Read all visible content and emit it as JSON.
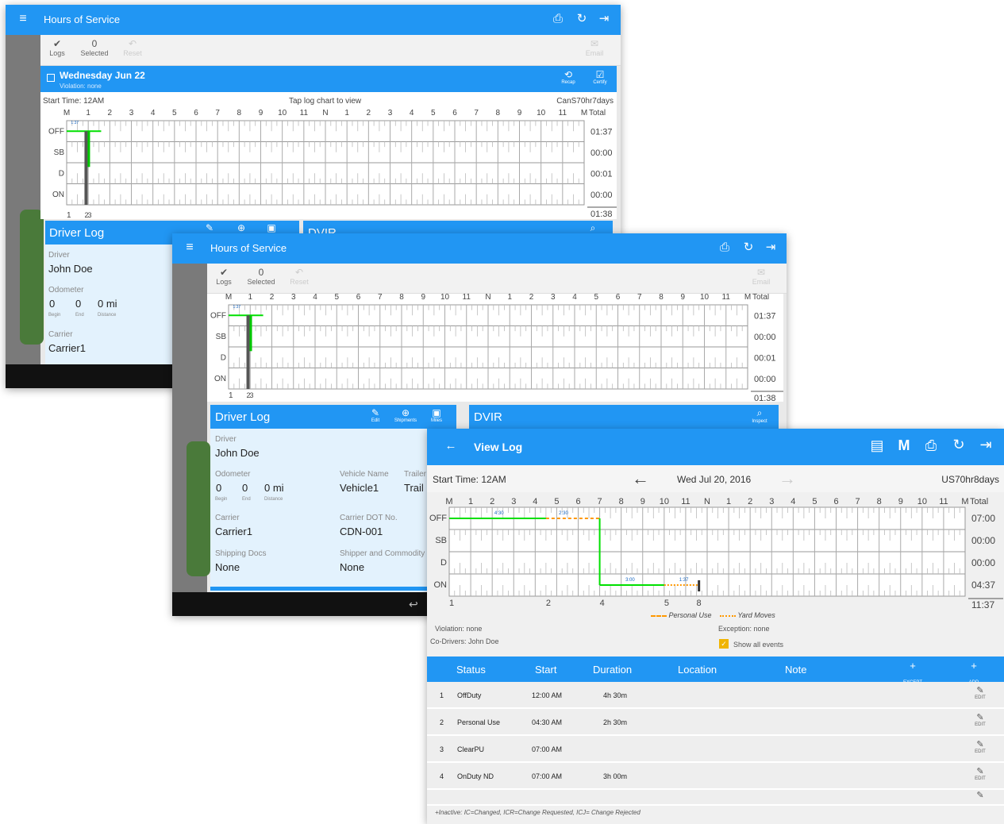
{
  "shot1": {
    "appbar": {
      "title": "Hours of Service"
    },
    "toolbar": {
      "logs": "Logs",
      "count": "0",
      "selected": "Selected",
      "reset": "Reset",
      "email": "Email"
    },
    "day": {
      "date": "Wednesday Jun 22",
      "violation": "Violation: none",
      "recap": "Recap",
      "certify": "Certify"
    },
    "chart": {
      "start_time": "Start Time: 12AM",
      "hint": "Tap log chart to view",
      "ruleset": "CanS70hr7days",
      "totals": [
        "01:37",
        "00:00",
        "00:01",
        "00:00"
      ],
      "grand_total": "01:38"
    },
    "driver_log": {
      "title": "Driver Log",
      "driver_label": "Driver",
      "driver": "John Doe",
      "odometer_label": "Odometer",
      "begin": "0",
      "end": "0",
      "distance": "0 mi",
      "begin_label": "Begin",
      "end_label": "End",
      "distance_label": "Distance",
      "carrier_label": "Carrier",
      "carrier": "Carrier1"
    },
    "dvir": {
      "title": "DVIR"
    }
  },
  "shot2": {
    "appbar": {
      "title": "Hours of Service"
    },
    "toolbar": {
      "logs": "Logs",
      "count": "0",
      "selected": "Selected",
      "reset": "Reset",
      "email": "Email"
    },
    "chart": {
      "totals": [
        "01:37",
        "00:00",
        "00:01",
        "00:00"
      ],
      "grand_total": "01:38"
    },
    "driver_log": {
      "title": "Driver Log",
      "edit": "Edit",
      "shipments": "Shipments",
      "miles": "Miles",
      "driver_label": "Driver",
      "driver": "John Doe",
      "odometer_label": "Odometer",
      "begin": "0",
      "end": "0",
      "distance": "0 mi",
      "begin_label": "Begin",
      "end_label": "End",
      "distance_label": "Distance",
      "vehicle_label": "Vehicle Name",
      "vehicle": "Vehicle1",
      "trailer_label": "Trailer",
      "trailer": "Trail",
      "carrier_label": "Carrier",
      "carrier": "Carrier1",
      "dot_label": "Carrier DOT No.",
      "dot": "CDN-001",
      "shipping_label": "Shipping Docs",
      "shipping": "None",
      "shipper_label": "Shipper and Commodity",
      "shipper": "None"
    },
    "dvir": {
      "title": "DVIR",
      "inspect": "Inspect"
    }
  },
  "shot3": {
    "appbar": {
      "title": "View Log"
    },
    "nav": {
      "start_time": "Start Time: 12AM",
      "date": "Wed Jul 20, 2016",
      "ruleset": "US70hr8days"
    },
    "chart": {
      "totals": [
        "07:00",
        "00:00",
        "00:00",
        "04:37"
      ],
      "grand_total": "11:37",
      "legend_personal": "Personal Use",
      "legend_yard": "Yard Moves"
    },
    "info": {
      "violation": "Violation: none",
      "codrivers": "Co-Drivers: John Doe",
      "exception": "Exception: none",
      "show_all": "Show all events"
    },
    "table": {
      "headers": {
        "status": "Status",
        "start": "Start",
        "duration": "Duration",
        "location": "Location",
        "note": "Note",
        "except": "EXCEPT",
        "add": "ADD"
      },
      "rows": [
        {
          "num": "1",
          "status": "OffDuty",
          "start": "12:00 AM",
          "duration": "4h 30m",
          "edit": "EDIT"
        },
        {
          "num": "2",
          "status": "Personal Use",
          "start": "04:30 AM",
          "duration": "2h 30m",
          "edit": "EDIT"
        },
        {
          "num": "3",
          "status": "ClearPU",
          "start": "07:00 AM",
          "duration": "",
          "edit": "EDIT"
        },
        {
          "num": "4",
          "status": "OnDuty ND",
          "start": "07:00 AM",
          "duration": "3h 00m",
          "edit": "EDIT"
        }
      ],
      "footnote": "+Inactive: IC=Changed, ICR=Change Requested, ICJ= Change Rejected"
    }
  },
  "colors": {
    "primary": "#2196f3",
    "panel": "#e3f2fd",
    "off_line": "#00e000",
    "personal_use": "#ff9800",
    "yard_moves": "#ff9800"
  }
}
